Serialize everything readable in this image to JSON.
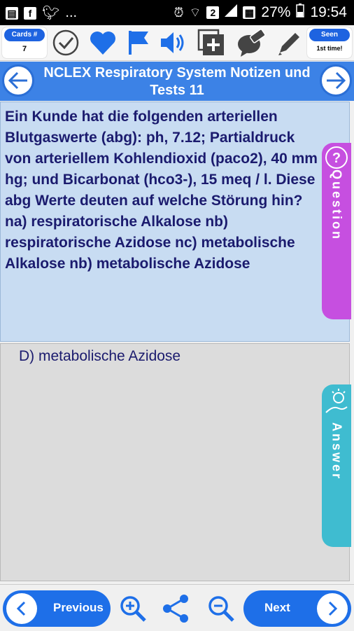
{
  "status_bar": {
    "left_icons": [
      "message-icon",
      "facebook-icon",
      "twitter-icon"
    ],
    "more": "...",
    "battery": "27%",
    "time": "19:54"
  },
  "toolbar": {
    "cards_label": "Cards #",
    "cards_value": "7",
    "seen_label": "Seen",
    "seen_value": "1st time!",
    "icons": [
      "check-icon",
      "heart-icon",
      "flag-icon",
      "speaker-icon",
      "add-card-icon",
      "eraser-icon",
      "pencil-icon"
    ]
  },
  "title": "NCLEX Respiratory System Notizen und Tests 11",
  "question": {
    "text": " Ein Kunde hat die folgenden arteriellen Blutgaswerte (abg): ph, 7.12; Partialdruck von arteriellem Kohlendioxid (paco2), 40 mm hg; und Bicarbonat (hco3-), 15 meq / l. Diese abg Werte deuten auf welche Störung hin?  na) respiratorische Alkalose  nb) respiratorische Azidose  nc) metabolische Alkalose  nb) metabolische Azidose",
    "tab_label": "Question"
  },
  "answer": {
    "text": "D) metabolische Azidose",
    "tab_label": "Answer"
  },
  "bottom": {
    "previous_label": "Previous",
    "next_label": "Next"
  },
  "colors": {
    "accent": "#1e6fe8",
    "title_bar": "#3c82e6",
    "question_bg": "#c8dcf2",
    "answer_bg": "#dcdcdc",
    "question_tab": "#c64fe0",
    "answer_tab": "#3fbcd0",
    "text": "#1b1b6e"
  }
}
